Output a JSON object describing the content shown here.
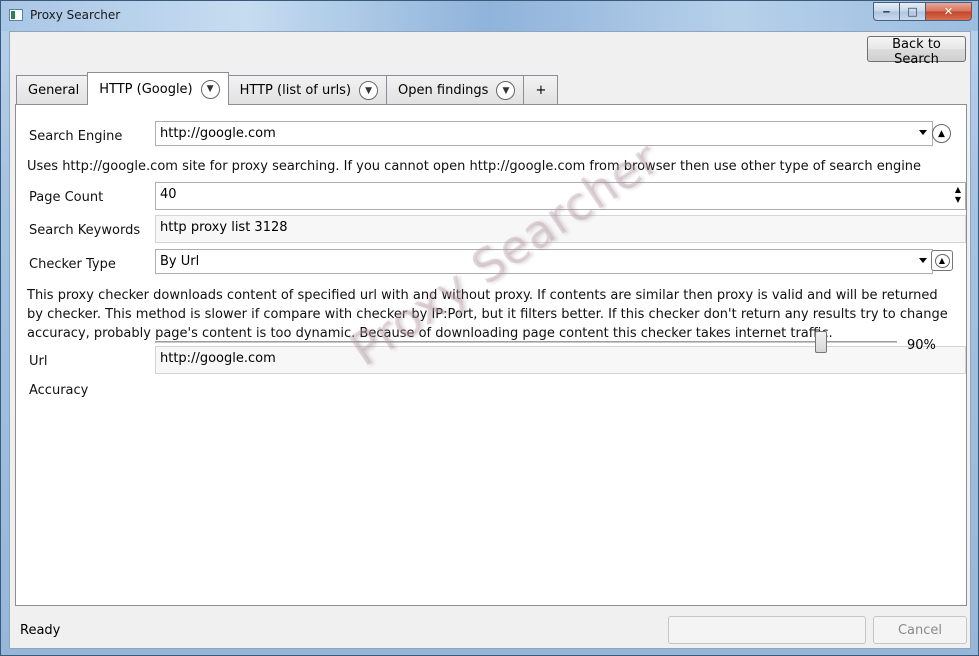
{
  "window": {
    "title": "Proxy Searcher",
    "controls": {
      "minimize": "‒",
      "maximize": "□",
      "close": "✕"
    }
  },
  "toolbar": {
    "back_label": "Back to Search"
  },
  "tabs": [
    {
      "label": "General",
      "has_dropdown": false,
      "active": false
    },
    {
      "label": "HTTP (Google)",
      "has_dropdown": true,
      "active": true
    },
    {
      "label": "HTTP (list of urls)",
      "has_dropdown": true,
      "active": false
    },
    {
      "label": "Open findings",
      "has_dropdown": true,
      "active": false
    },
    {
      "label": "+",
      "has_dropdown": false,
      "active": false
    }
  ],
  "icons": {
    "tab_dropdown": "chevron-down-icon",
    "collapse": "chevron-up-icon",
    "dropdown_arrow": "triangle-down-icon"
  },
  "form": {
    "search_engine": {
      "label": "Search Engine",
      "value": "http://google.com",
      "description": "Uses http://google.com site for proxy searching. If you cannot open http://google.com from browser then use other type of search engine"
    },
    "page_count": {
      "label": "Page Count",
      "value": "40"
    },
    "search_keywords": {
      "label": "Search Keywords",
      "value": "http proxy list 3128"
    },
    "checker_type": {
      "label": "Checker Type",
      "value": "By Url",
      "description": "This proxy checker downloads content of specified url with and without proxy. If contents are similar then proxy is valid and will be returned by checker. This method is slower if compare with checker by IP:Port, but it filters better. If this checker don't return any results try to change accuracy, probably page's content is too dynamic. Because of downloading page content this checker takes internet traffic."
    },
    "url": {
      "label": "Url",
      "value": "http://google.com"
    },
    "accuracy": {
      "label": "Accuracy",
      "value_text": "90%",
      "fraction": 0.9
    }
  },
  "watermark": "Proxy Searcher",
  "status": {
    "text": "Ready",
    "progress_label": "",
    "cancel_label": "Cancel"
  }
}
